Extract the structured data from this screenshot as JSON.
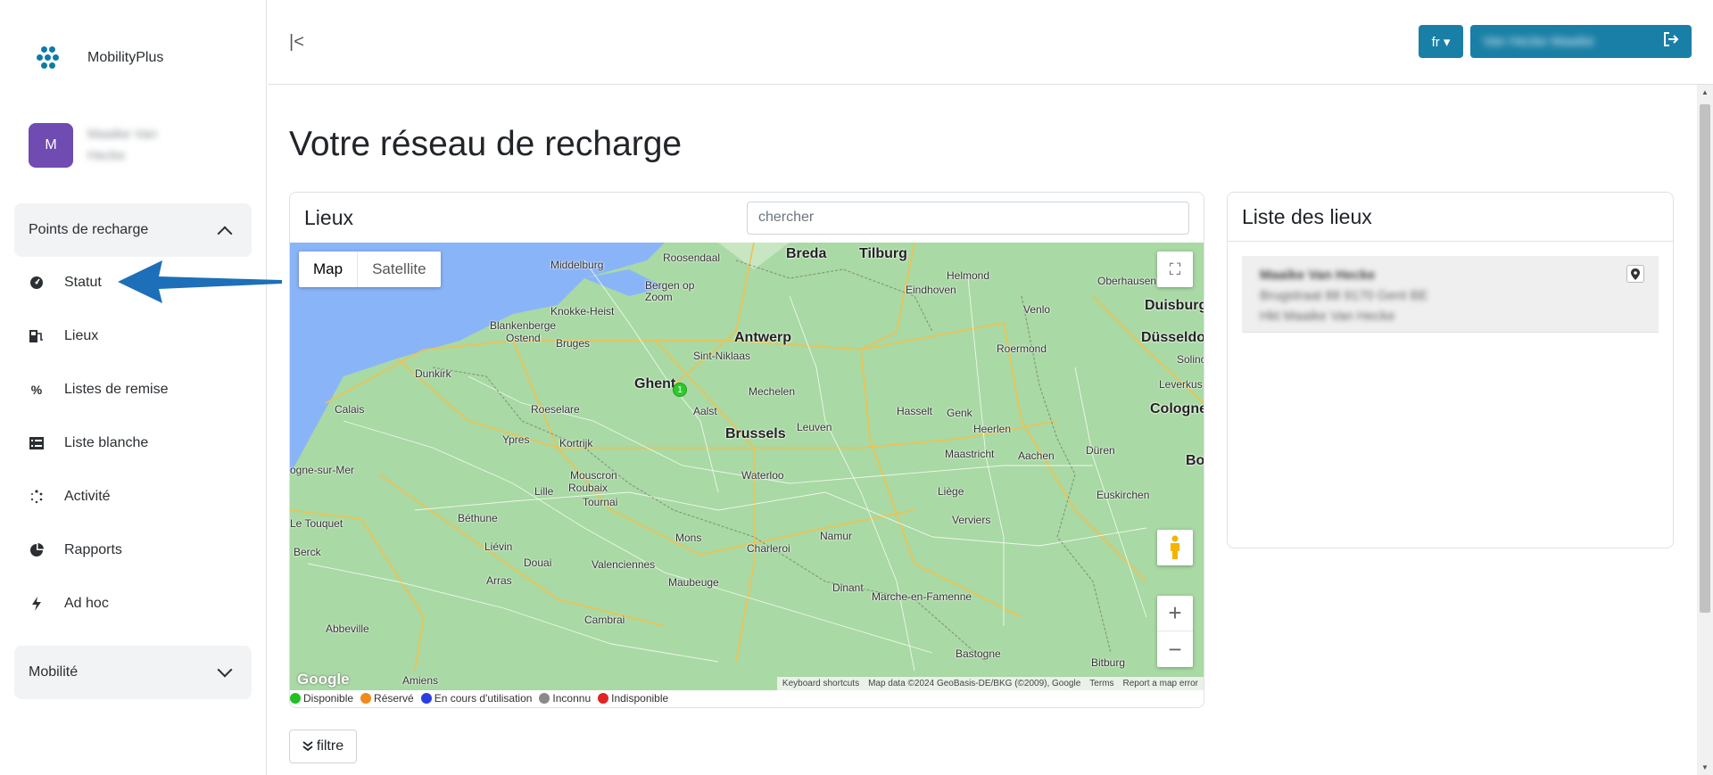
{
  "brand": {
    "name": "MobilityPlus"
  },
  "user": {
    "initial": "M",
    "name": "Maaike Van Hecke"
  },
  "sidebar": {
    "groups": [
      {
        "label": "Points de recharge",
        "expanded": true
      },
      {
        "label": "Mobilité",
        "expanded": false
      }
    ],
    "items": [
      {
        "label": "Statut",
        "icon": "gauge-icon"
      },
      {
        "label": "Lieux",
        "icon": "charging-station-icon"
      },
      {
        "label": "Listes de remise",
        "icon": "percent-icon"
      },
      {
        "label": "Liste blanche",
        "icon": "list-icon"
      },
      {
        "label": "Activité",
        "icon": "spinner-icon"
      },
      {
        "label": "Rapports",
        "icon": "pie-chart-icon"
      },
      {
        "label": "Ad hoc",
        "icon": "bolt-icon"
      }
    ]
  },
  "topbar": {
    "language": "fr",
    "user_button": "Van Hecke Maaike"
  },
  "page": {
    "title": "Votre réseau de recharge"
  },
  "map_card": {
    "title": "Lieux",
    "search_placeholder": "chercher",
    "map_type": {
      "map": "Map",
      "satellite": "Satellite",
      "selected": "Map"
    },
    "cluster_count": "1",
    "google": "Google",
    "attribution": [
      "Keyboard shortcuts",
      "Map data ©2024 GeoBasis-DE/BKG (©2009), Google",
      "Terms",
      "Report a map error"
    ],
    "cities": [
      {
        "name": "Middelburg"
      },
      {
        "name": "Roosendaal"
      },
      {
        "name": "Breda"
      },
      {
        "name": "Tilburg"
      },
      {
        "name": "Helmond"
      },
      {
        "name": "Oberhausen"
      },
      {
        "name": "Bergen op Zoom"
      },
      {
        "name": "Eindhoven"
      },
      {
        "name": "Venlo"
      },
      {
        "name": "Duisburg"
      },
      {
        "name": "Knokke-Heist"
      },
      {
        "name": "Blankenberge"
      },
      {
        "name": "Ostend"
      },
      {
        "name": "Bruges"
      },
      {
        "name": "Sint-Niklaas"
      },
      {
        "name": "Antwerp"
      },
      {
        "name": "Roermond"
      },
      {
        "name": "Düsseldorf"
      },
      {
        "name": "Dunkirk"
      },
      {
        "name": "Ghent"
      },
      {
        "name": "Mechelen"
      },
      {
        "name": "Leverkus"
      },
      {
        "name": "Calais"
      },
      {
        "name": "Roeselare"
      },
      {
        "name": "Aalst"
      },
      {
        "name": "Hasselt"
      },
      {
        "name": "Genk"
      },
      {
        "name": "Cologne"
      },
      {
        "name": "Ypres"
      },
      {
        "name": "Kortrijk"
      },
      {
        "name": "Brussels"
      },
      {
        "name": "Leuven"
      },
      {
        "name": "Heerlen"
      },
      {
        "name": "Maastricht"
      },
      {
        "name": "Aachen"
      },
      {
        "name": "Düren"
      },
      {
        "name": "Mouscron"
      },
      {
        "name": "Roubaix"
      },
      {
        "name": "Waterloo"
      },
      {
        "name": "Lille"
      },
      {
        "name": "Tournai"
      },
      {
        "name": "Liège"
      },
      {
        "name": "Euskirchen"
      },
      {
        "name": "Béthune"
      },
      {
        "name": "Mons"
      },
      {
        "name": "Namur"
      },
      {
        "name": "Verviers"
      },
      {
        "name": "Charleroi"
      },
      {
        "name": "Liévin"
      },
      {
        "name": "Douai"
      },
      {
        "name": "Valenciennes"
      },
      {
        "name": "Arras"
      },
      {
        "name": "Maubeuge"
      },
      {
        "name": "Dinant"
      },
      {
        "name": "Marche-en-Famenne"
      },
      {
        "name": "Cambrai"
      },
      {
        "name": "Abbeville"
      },
      {
        "name": "Bastogne"
      },
      {
        "name": "Amiens"
      },
      {
        "name": "Bitburg"
      },
      {
        "name": "ogne-sur-Mer"
      },
      {
        "name": "Le Touquet"
      },
      {
        "name": "Berck"
      },
      {
        "name": "Bo"
      },
      {
        "name": "Solinc"
      }
    ]
  },
  "legend": [
    {
      "label": "Disponible",
      "color": "#22c022"
    },
    {
      "label": "Réservé",
      "color": "#f08a1c"
    },
    {
      "label": "En cours d'utilisation",
      "color": "#2a3ee0"
    },
    {
      "label": "Inconnu",
      "color": "#8a8a8a"
    },
    {
      "label": "Indisponible",
      "color": "#e02424"
    }
  ],
  "filter": {
    "label": "filtre"
  },
  "list_card": {
    "title": "Liste des lieux",
    "items": [
      {
        "lines": [
          "Maaike Van Hecke",
          "Brugstraat 88 9170 Gent BE",
          "Hkt Maaike Van Hecke"
        ]
      }
    ]
  }
}
